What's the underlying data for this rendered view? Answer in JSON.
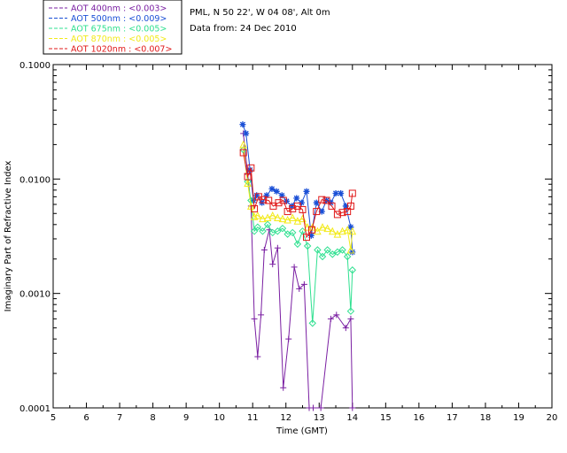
{
  "chart_data": {
    "type": "line",
    "title": "",
    "xlabel": "Time (GMT)",
    "ylabel": "Imaginary Part of Refractive Index",
    "xlim": [
      5,
      20
    ],
    "ylim": [
      0.0001,
      0.1
    ],
    "yscale": "log",
    "grid": false,
    "legend_placement": "top-left",
    "x_ticks": [
      "5",
      "6",
      "7",
      "8",
      "9",
      "10",
      "11",
      "12",
      "13",
      "14",
      "15",
      "16",
      "17",
      "18",
      "19",
      "20"
    ],
    "y_ticks": [
      {
        "value": 0.0001,
        "label": "0.0001"
      },
      {
        "value": 0.001,
        "label": "0.0010"
      },
      {
        "value": 0.01,
        "label": "0.0100"
      },
      {
        "value": 0.1,
        "label": "0.1000"
      }
    ],
    "annotations": [
      "PML, N 50 22', W 04 08', Alt 0m",
      "Data from: 24 Dec 2010"
    ],
    "series": [
      {
        "name": "AOT  400nm : <0.003>",
        "color": "#7a1fa2",
        "marker": "plus",
        "x": [
          10.72,
          10.85,
          10.95,
          11.05,
          11.15,
          11.25,
          11.35,
          11.5,
          11.6,
          11.75,
          11.92,
          12.08,
          12.25,
          12.4,
          12.55,
          12.7,
          12.82,
          13.05,
          13.35,
          13.52,
          13.8,
          13.95,
          14.0
        ],
        "y": [
          0.025,
          0.011,
          0.0058,
          0.0006,
          0.00028,
          0.00065,
          0.0024,
          0.0036,
          0.0018,
          0.0025,
          0.00015,
          0.0004,
          0.0017,
          0.0011,
          0.0012,
          8e-05,
          8e-05,
          8e-05,
          0.0006,
          0.00065,
          0.0005,
          0.0006,
          8e-05
        ]
      },
      {
        "name": "AOT  500nm : <0.009>",
        "color": "#1a4fd6",
        "marker": "asterisk",
        "x": [
          10.7,
          10.8,
          10.92,
          11.02,
          11.12,
          11.28,
          11.42,
          11.58,
          11.72,
          11.88,
          12.02,
          12.18,
          12.32,
          12.47,
          12.62,
          12.76,
          12.92,
          13.08,
          13.22,
          13.35,
          13.5,
          13.65,
          13.8,
          13.95,
          14.0
        ],
        "y": [
          0.03,
          0.025,
          0.012,
          0.0065,
          0.0072,
          0.0062,
          0.0072,
          0.0082,
          0.0078,
          0.0072,
          0.0064,
          0.0058,
          0.0068,
          0.0062,
          0.0078,
          0.0032,
          0.0062,
          0.0052,
          0.0065,
          0.0062,
          0.0075,
          0.0075,
          0.0058,
          0.0038,
          0.0023
        ]
      },
      {
        "name": "AOT  675nm : <0.005>",
        "color": "#2fe090",
        "marker": "diamond",
        "x": [
          10.72,
          10.85,
          10.95,
          11.05,
          11.15,
          11.3,
          11.45,
          11.6,
          11.75,
          11.9,
          12.05,
          12.2,
          12.35,
          12.5,
          12.65,
          12.8,
          12.95,
          13.1,
          13.25,
          13.4,
          13.55,
          13.7,
          13.85,
          13.95,
          14.0
        ],
        "y": [
          0.018,
          0.0095,
          0.0065,
          0.0035,
          0.0038,
          0.0035,
          0.004,
          0.0034,
          0.0035,
          0.0037,
          0.0033,
          0.0034,
          0.0027,
          0.0035,
          0.0026,
          0.00055,
          0.0024,
          0.0021,
          0.0024,
          0.0022,
          0.0023,
          0.0024,
          0.0021,
          0.0007,
          0.0016
        ]
      },
      {
        "name": "AOT  870nm : <0.005>",
        "color": "#f2ea1a",
        "marker": "triangle",
        "x": [
          10.72,
          10.85,
          10.95,
          11.05,
          11.15,
          11.3,
          11.45,
          11.6,
          11.75,
          11.9,
          12.05,
          12.2,
          12.35,
          12.5,
          12.65,
          12.8,
          12.95,
          13.1,
          13.25,
          13.4,
          13.55,
          13.7,
          13.85,
          13.95,
          14.0
        ],
        "y": [
          0.02,
          0.0092,
          0.0058,
          0.0047,
          0.0048,
          0.0045,
          0.0046,
          0.0048,
          0.0046,
          0.0045,
          0.0044,
          0.0046,
          0.0043,
          0.0045,
          0.0038,
          0.0038,
          0.0035,
          0.0038,
          0.0037,
          0.0035,
          0.0033,
          0.0035,
          0.0036,
          0.0024,
          0.0035
        ]
      },
      {
        "name": "AOT 1020nm : <0.007>",
        "color": "#e01818",
        "marker": "square",
        "x": [
          10.72,
          10.85,
          10.95,
          11.05,
          11.18,
          11.32,
          11.48,
          11.62,
          11.78,
          11.92,
          12.05,
          12.2,
          12.35,
          12.5,
          12.62,
          12.78,
          12.92,
          13.08,
          13.22,
          13.38,
          13.55,
          13.7,
          13.85,
          13.95,
          14.0
        ],
        "y": [
          0.017,
          0.0105,
          0.0125,
          0.0055,
          0.007,
          0.0066,
          0.0065,
          0.0058,
          0.0062,
          0.0065,
          0.0052,
          0.0055,
          0.0058,
          0.0054,
          0.0031,
          0.0036,
          0.0052,
          0.0066,
          0.0065,
          0.0058,
          0.0049,
          0.0051,
          0.0052,
          0.0058,
          0.0075
        ]
      }
    ]
  }
}
